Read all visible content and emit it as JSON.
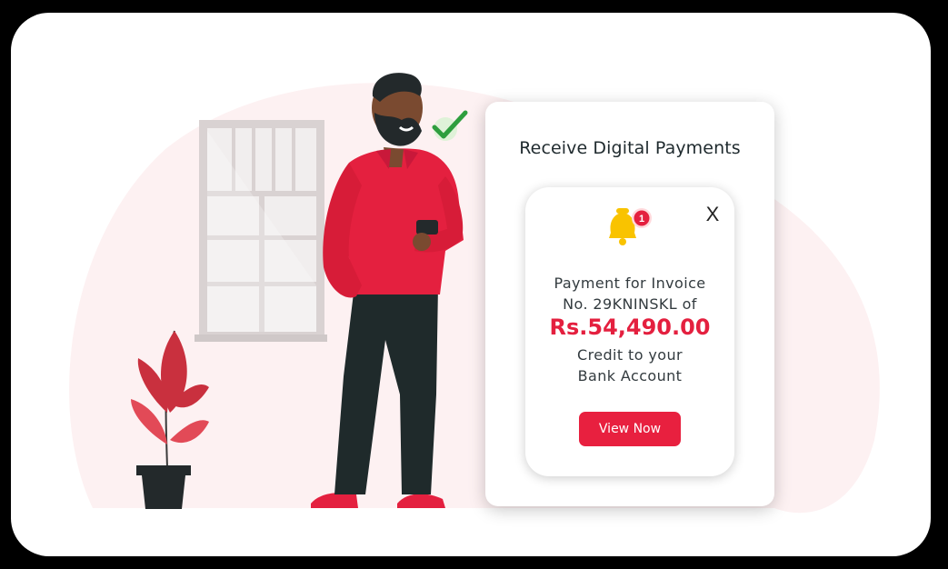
{
  "panel": {
    "title": "Receive Digital Payments"
  },
  "notification": {
    "badge_count": "1",
    "close_label": "X",
    "line1": "Payment for Invoice",
    "line2": "No. 29KNINSKL of",
    "amount": "Rs.54,490.00",
    "line3": "Credit to your",
    "line4": "Bank Account",
    "button_label": "View Now"
  },
  "colors": {
    "accent": "#e8203f",
    "bell": "#f9c300",
    "check": "#2e9e3e",
    "blob": "#fdf1f2"
  },
  "icons": {
    "bell": "bell-icon",
    "check": "checkmark-icon",
    "close": "close-icon"
  }
}
